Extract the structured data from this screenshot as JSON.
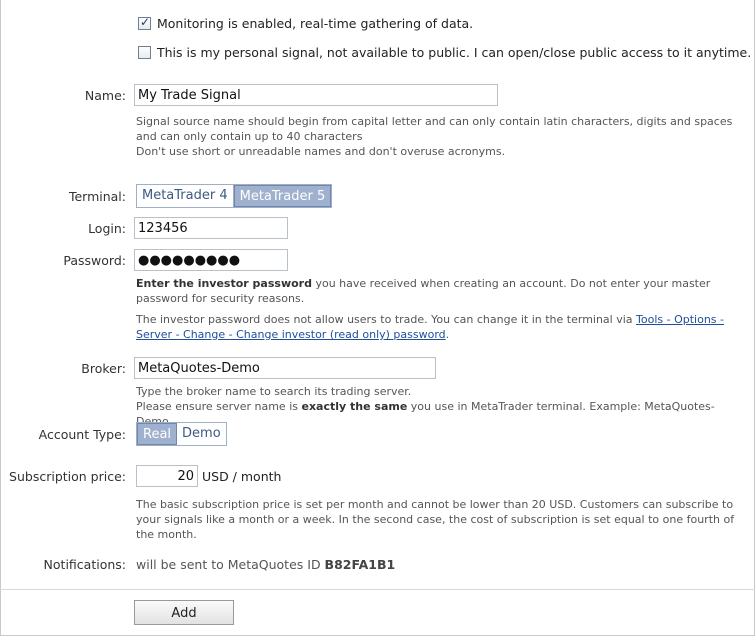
{
  "monitoring": {
    "checked": true,
    "label": "Monitoring is enabled, real-time gathering of data."
  },
  "personal": {
    "checked": false,
    "label": "This is my personal signal, not available to public. I can open/close public access to it anytime."
  },
  "name": {
    "label": "Name:",
    "value": "My Trade Signal",
    "hint1": "Signal source name should begin from capital letter and can only contain latin characters, digits and spaces and can only contain up to 40 characters",
    "hint2": "Don't use short or unreadable names and don't overuse acronyms."
  },
  "terminal": {
    "label": "Terminal:",
    "options": [
      "MetaTrader 4",
      "MetaTrader 5"
    ],
    "selected": "MetaTrader 5"
  },
  "login": {
    "label": "Login:",
    "value": "123456"
  },
  "password": {
    "label": "Password:",
    "value": "●●●●●●●●●",
    "hint_bold": "Enter the investor password",
    "hint_rest": " you have received when creating an account. Do not enter your master password for security reasons.",
    "hint2_text": "The investor password does not allow users to trade. You can change it in the terminal via ",
    "hint2_link": "Tools - Options - Server - Change - Change investor (read only) password",
    "hint2_end": "."
  },
  "broker": {
    "label": "Broker:",
    "value": "MetaQuotes-Demo",
    "hint1": "Type the broker name to search its trading server.",
    "hint2_a": "Please ensure server name is ",
    "hint2_bold": "exactly the same",
    "hint2_b": " you use in MetaTrader terminal. Example: MetaQuotes-Demo"
  },
  "account_type": {
    "label": "Account Type:",
    "options": [
      "Real",
      "Demo"
    ],
    "selected": "Real"
  },
  "subscription": {
    "label": "Subscription price:",
    "value": "20",
    "unit": "USD / month",
    "hint": "The basic subscription price is set per month and cannot be lower than 20 USD. Customers can subscribe to your signals like a month or a week. In the second case, the cost of subscription is set equal to one fourth of the month."
  },
  "notifications": {
    "label": "Notifications:",
    "text": "will be sent to MetaQuotes ID ",
    "id": "B82FA1B1"
  },
  "add_button": "Add"
}
